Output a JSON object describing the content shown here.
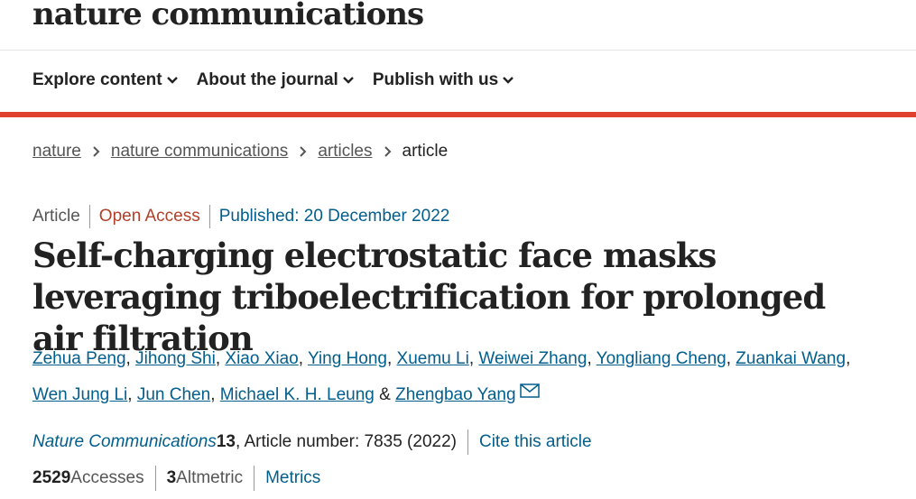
{
  "header": {
    "logo": "nature communications"
  },
  "nav": {
    "items": [
      {
        "label": "Explore content"
      },
      {
        "label": "About the journal"
      },
      {
        "label": "Publish with us"
      }
    ]
  },
  "breadcrumb": {
    "items": [
      "nature",
      "nature communications",
      "articles"
    ],
    "current": "article"
  },
  "article_meta": {
    "type": "Article",
    "access": "Open Access",
    "published": "Published: 20 December 2022"
  },
  "article": {
    "title": "Self-charging electrostatic face masks leveraging triboelectrification for prolonged air filtration"
  },
  "authors": {
    "list": [
      "Zehua Peng",
      "Jihong Shi",
      "Xiao Xiao",
      "Ying Hong",
      "Xuemu Li",
      "Weiwei Zhang",
      "Yongliang Cheng",
      "Zuankai Wang",
      "Wen Jung Li",
      "Jun Chen",
      "Michael K. H. Leung"
    ],
    "last": "Zhengbao Yang",
    "conjunction": "&"
  },
  "journal_info": {
    "journal": "Nature Communications",
    "volume": "13",
    "rest": ", Article number: 7835 (2022)",
    "cite": "Cite this article"
  },
  "metrics": {
    "accesses_count": "2529",
    "accesses_label": "Accesses",
    "altmetric_count": "3",
    "altmetric_label": "Altmetric",
    "metrics_link": "Metrics"
  },
  "colors": {
    "link": "#025e8d",
    "accent_bar": "#e0402e",
    "open_access": "#b0402b"
  }
}
